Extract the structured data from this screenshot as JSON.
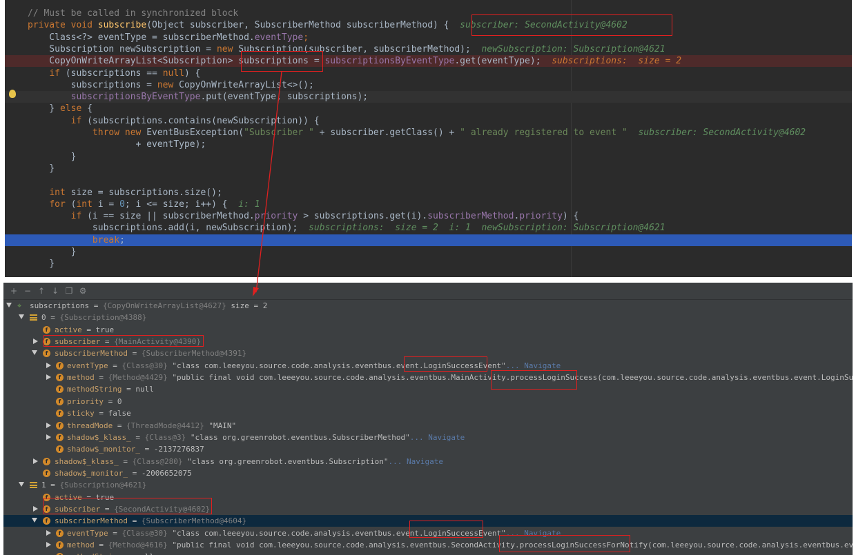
{
  "editor": {
    "lines": [
      {
        "id": "comment",
        "segs": [
          [
            "cmt",
            "// Must be called in synchronized block"
          ]
        ]
      },
      {
        "id": "signature",
        "segs": [
          [
            "kw",
            "private void "
          ],
          [
            "fn",
            "subscribe"
          ],
          [
            "",
            "(Object subscriber, SubscriberMethod subscriberMethod) {  "
          ],
          [
            "hint",
            "subscriber: SecondActivity@4602"
          ]
        ]
      },
      {
        "id": "eventtype",
        "segs": [
          [
            "",
            "    Class<?> eventType = subscriberMethod."
          ],
          [
            "fld",
            "eventType"
          ],
          [
            "kw",
            ";"
          ]
        ]
      },
      {
        "id": "newsub",
        "segs": [
          [
            "",
            "    Subscription newSubscription = "
          ],
          [
            "kw",
            "new "
          ],
          [
            "",
            "Subscription(subscriber, subscriberMethod);  "
          ],
          [
            "hint",
            "newSubscription: Subscription@4621"
          ]
        ]
      },
      {
        "id": "cowa",
        "segs": [
          [
            "",
            "    CopyOnWriteArrayList<Subscription> subscriptions = "
          ],
          [
            "fld",
            "subscriptionsByEventType"
          ],
          [
            "",
            ".get(eventType);  "
          ],
          [
            "hintr",
            "subscriptions:  size = 2"
          ]
        ]
      },
      {
        "id": "ifnull",
        "segs": [
          [
            "",
            "    "
          ],
          [
            "kw",
            "if "
          ],
          [
            "",
            "(subscriptions == "
          ],
          [
            "kw",
            "null"
          ],
          [
            "",
            ") {"
          ]
        ]
      },
      {
        "id": "assign",
        "segs": [
          [
            "",
            "        subscriptions = "
          ],
          [
            "kw",
            "new "
          ],
          [
            "",
            "CopyOnWriteArrayList<>();"
          ]
        ]
      },
      {
        "id": "put",
        "segs": [
          [
            "",
            "        "
          ],
          [
            "fld",
            "subscriptionsByEventType"
          ],
          [
            "",
            ".put(eventType, subscriptions);"
          ]
        ]
      },
      {
        "id": "else",
        "segs": [
          [
            "",
            "    } "
          ],
          [
            "kw",
            "else "
          ],
          [
            "",
            "{"
          ]
        ]
      },
      {
        "id": "contains",
        "segs": [
          [
            "",
            "        "
          ],
          [
            "kw",
            "if "
          ],
          [
            "",
            "(subscriptions.contains(newSubscription)) {"
          ]
        ]
      },
      {
        "id": "throw",
        "segs": [
          [
            "",
            "            "
          ],
          [
            "kw",
            "throw new "
          ],
          [
            "",
            "EventBusException("
          ],
          [
            "str",
            "\"Subscriber \""
          ],
          [
            "",
            " + subscriber.getClass() + "
          ],
          [
            "str",
            "\" already registered to event \""
          ],
          [
            "",
            "  "
          ],
          [
            "hint",
            "subscriber: SecondActivity@4602"
          ]
        ]
      },
      {
        "id": "throw2",
        "segs": [
          [
            "",
            "                    + eventType);"
          ]
        ]
      },
      {
        "id": "close1",
        "segs": [
          [
            "",
            "        }"
          ]
        ]
      },
      {
        "id": "close2",
        "segs": [
          [
            "",
            "    }"
          ]
        ]
      },
      {
        "id": "blank",
        "segs": [
          [
            "",
            ""
          ]
        ]
      },
      {
        "id": "size",
        "segs": [
          [
            "",
            "    "
          ],
          [
            "kw",
            "int "
          ],
          [
            "",
            "size = subscriptions.size();"
          ]
        ]
      },
      {
        "id": "for",
        "segs": [
          [
            "",
            "    "
          ],
          [
            "kw",
            "for "
          ],
          [
            "",
            "("
          ],
          [
            "kw",
            "int "
          ],
          [
            "",
            "i = "
          ],
          [
            "num",
            "0"
          ],
          [
            "",
            "; i <= size; i++) {  "
          ],
          [
            "hint",
            "i: 1"
          ]
        ]
      },
      {
        "id": "ifprio",
        "segs": [
          [
            "",
            "        "
          ],
          [
            "kw",
            "if "
          ],
          [
            "",
            "(i == size || subscriberMethod."
          ],
          [
            "fld",
            "priority"
          ],
          [
            "",
            " > subscriptions.get(i)."
          ],
          [
            "fld",
            "subscriberMethod"
          ],
          [
            "",
            "."
          ],
          [
            "fld",
            "priority"
          ],
          [
            "",
            ") {"
          ]
        ]
      },
      {
        "id": "add",
        "segs": [
          [
            "",
            "            subscriptions.add(i, newSubscription);  "
          ],
          [
            "hint",
            "subscriptions:  size = 2  i: 1  newSubscription: Subscription@4621"
          ]
        ]
      },
      {
        "id": "break",
        "segs": [
          [
            "",
            "            "
          ],
          [
            "kw",
            "break"
          ],
          [
            "",
            ";"
          ]
        ]
      },
      {
        "id": "close3",
        "segs": [
          [
            "",
            "        }"
          ]
        ]
      },
      {
        "id": "close4",
        "segs": [
          [
            "",
            "    }"
          ]
        ]
      }
    ]
  },
  "debugger": {
    "toolbar_icons": [
      "add-watch-icon",
      "remove-watch-icon",
      "move-up-icon",
      "move-down-icon",
      "copy-icon",
      "settings-icon"
    ],
    "rows": [
      {
        "lvl": 0,
        "arrow": "open",
        "icon": "watch",
        "name": "subscriptions",
        "ref": "{CopyOnWriteArrayList@4627}",
        "val": "size = 2"
      },
      {
        "lvl": 1,
        "arrow": "open",
        "icon": "list",
        "name": "0",
        "ref": "{Subscription@4388}",
        "val": ""
      },
      {
        "lvl": 2,
        "arrow": "",
        "icon": "f",
        "name": "active",
        "ref": "",
        "val": "true"
      },
      {
        "lvl": 2,
        "arrow": "closed",
        "icon": "f",
        "name": "subscriber",
        "ref": "{MainActivity@4390}",
        "val": ""
      },
      {
        "lvl": 2,
        "arrow": "open",
        "icon": "f",
        "name": "subscriberMethod",
        "ref": "{SubscriberMethod@4391}",
        "val": ""
      },
      {
        "lvl": 3,
        "arrow": "closed",
        "icon": "f",
        "name": "eventType",
        "ref": "{Class@30}",
        "val": "\"class com.leeeyou.source.code.analysis.eventbus.event.LoginSuccessEvent\"",
        "nav": "... Navigate"
      },
      {
        "lvl": 3,
        "arrow": "closed",
        "icon": "f",
        "name": "method",
        "ref": "{Method@4429}",
        "val": "\"public final void com.leeeyou.source.code.analysis.eventbus.MainActivity.processLoginSuccess(com.leeeyou.source.code.analysis.eventbus.event.LoginSuccessEvent)\""
      },
      {
        "lvl": 3,
        "arrow": "",
        "icon": "f",
        "name": "methodString",
        "ref": "",
        "val": "null"
      },
      {
        "lvl": 3,
        "arrow": "",
        "icon": "f",
        "name": "priority",
        "ref": "",
        "val": "0"
      },
      {
        "lvl": 3,
        "arrow": "",
        "icon": "f",
        "name": "sticky",
        "ref": "",
        "val": "false"
      },
      {
        "lvl": 3,
        "arrow": "closed",
        "icon": "f",
        "name": "threadMode",
        "ref": "{ThreadMode@4412}",
        "val": "\"MAIN\""
      },
      {
        "lvl": 3,
        "arrow": "closed",
        "icon": "f",
        "name": "shadow$_klass_",
        "ref": "{Class@3}",
        "val": "\"class org.greenrobot.eventbus.SubscriberMethod\"",
        "nav": "... Navigate"
      },
      {
        "lvl": 3,
        "arrow": "",
        "icon": "f",
        "name": "shadow$_monitor_",
        "ref": "",
        "val": "-2137276837"
      },
      {
        "lvl": 2,
        "arrow": "closed",
        "icon": "f",
        "name": "shadow$_klass_",
        "ref": "{Class@280}",
        "val": "\"class org.greenrobot.eventbus.Subscription\"",
        "nav": "... Navigate"
      },
      {
        "lvl": 2,
        "arrow": "",
        "icon": "f",
        "name": "shadow$_monitor_",
        "ref": "",
        "val": "-2006652075"
      },
      {
        "lvl": 1,
        "arrow": "open",
        "icon": "list",
        "name": "1",
        "ref": "{Subscription@4621}",
        "val": ""
      },
      {
        "lvl": 2,
        "arrow": "",
        "icon": "f",
        "name": "active",
        "ref": "",
        "val": "true"
      },
      {
        "lvl": 2,
        "arrow": "closed",
        "icon": "f",
        "name": "subscriber",
        "ref": "{SecondActivity@4602}",
        "val": ""
      },
      {
        "lvl": 2,
        "arrow": "open",
        "icon": "f",
        "name": "subscriberMethod",
        "ref": "{SubscriberMethod@4604}",
        "val": "",
        "sel": true
      },
      {
        "lvl": 3,
        "arrow": "closed",
        "icon": "f",
        "name": "eventType",
        "ref": "{Class@30}",
        "val": "\"class com.leeeyou.source.code.analysis.eventbus.event.LoginSuccessEvent\"",
        "nav": "... Navigate"
      },
      {
        "lvl": 3,
        "arrow": "closed",
        "icon": "f",
        "name": "method",
        "ref": "{Method@4616}",
        "val": "\"public final void com.leeeyou.source.code.analysis.eventbus.SecondActivity.processLoginSuccessForNotify(com.leeeyou.source.code.analysis.eventbus.event.L..."
      },
      {
        "lvl": 3,
        "arrow": "",
        "icon": "f",
        "name": "methodString",
        "ref": "",
        "val": "null"
      }
    ]
  },
  "colors": {
    "editor_bg": "#2b2b2b",
    "debugger_bg": "#3c3f41",
    "highlight_red": "#e02020",
    "exec_line": "#2d5ab7"
  }
}
